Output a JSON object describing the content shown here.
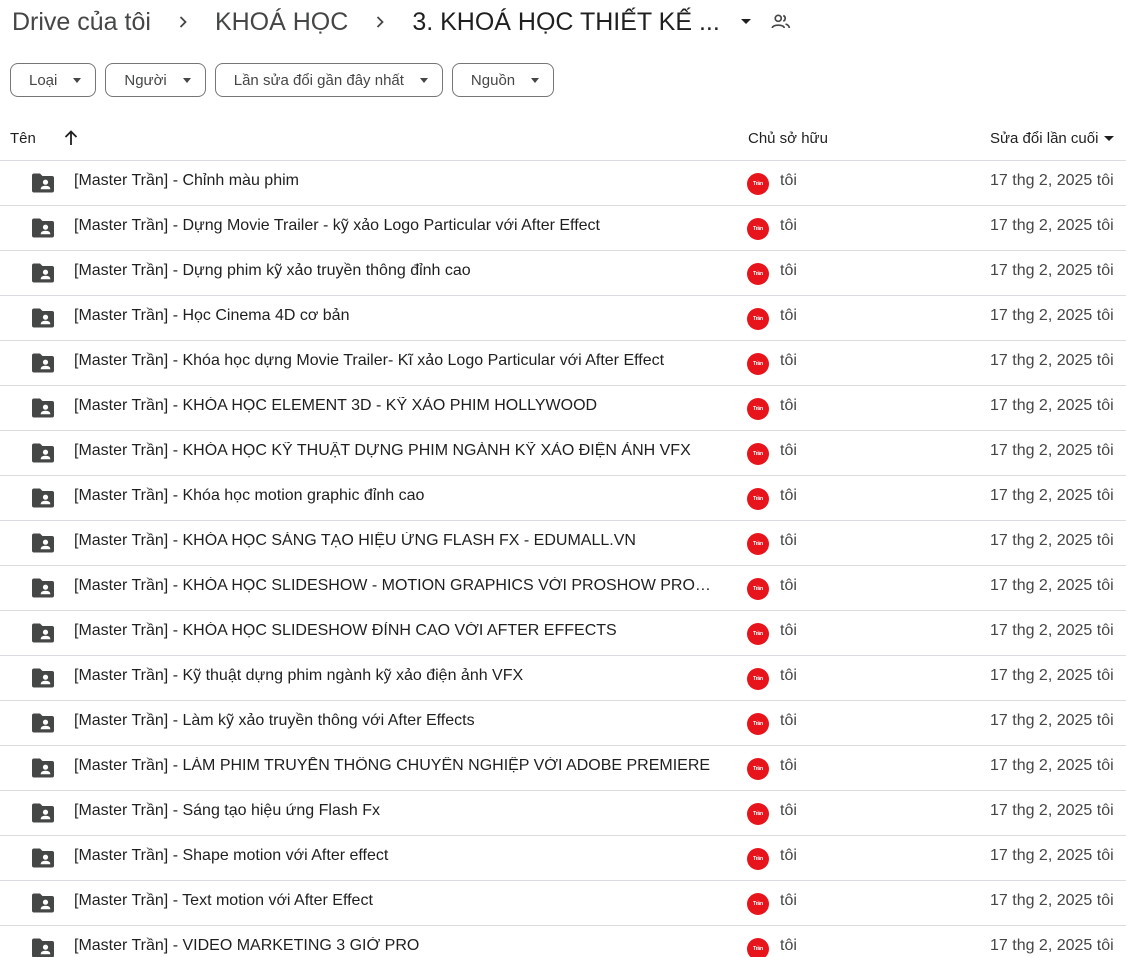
{
  "breadcrumb": {
    "root": "Drive của tôi",
    "parent": "KHOÁ HỌC",
    "current": "3. KHOÁ HỌC THIẾT KẾ ..."
  },
  "filters": [
    "Loại",
    "Người",
    "Lần sửa đổi gần đây nhất",
    "Nguồn"
  ],
  "columns": {
    "name": "Tên",
    "owner": "Chủ sở hữu",
    "modified": "Sửa đổi lần cuối"
  },
  "avatar_text": "Trần",
  "rows": [
    {
      "name": "[Master Trần] - Chỉnh màu phim",
      "owner": "tôi",
      "modified": "17 thg 2, 2025 tôi"
    },
    {
      "name": "[Master Trần] - Dựng Movie Trailer - kỹ xảo Logo Particular với After Effect",
      "owner": "tôi",
      "modified": "17 thg 2, 2025 tôi"
    },
    {
      "name": "[Master Trần] - Dựng phim kỹ xảo truyền thông đỉnh cao",
      "owner": "tôi",
      "modified": "17 thg 2, 2025 tôi"
    },
    {
      "name": "[Master Trần] - Học Cinema 4D cơ bản",
      "owner": "tôi",
      "modified": "17 thg 2, 2025 tôi"
    },
    {
      "name": "[Master Trần] - Khóa học dựng Movie Trailer- Kĩ xảo Logo Particular với After Effect",
      "owner": "tôi",
      "modified": "17 thg 2, 2025 tôi"
    },
    {
      "name": "[Master Trần] - KHÓA HỌC ELEMENT 3D - KỸ XẢO PHIM HOLLYWOOD",
      "owner": "tôi",
      "modified": "17 thg 2, 2025 tôi"
    },
    {
      "name": "[Master Trần] - KHÓA HỌC KỸ THUẬT DỰNG PHIM NGÀNH KỸ XẢO ĐIỆN ẢNH VFX",
      "owner": "tôi",
      "modified": "17 thg 2, 2025 tôi"
    },
    {
      "name": "[Master Trần] - Khóa học motion graphic đỉnh cao",
      "owner": "tôi",
      "modified": "17 thg 2, 2025 tôi"
    },
    {
      "name": "[Master Trần] - KHÓA HỌC SÁNG TẠO HIỆU ỨNG FLASH FX - EDUMALL.VN",
      "owner": "tôi",
      "modified": "17 thg 2, 2025 tôi"
    },
    {
      "name": "[Master Trần] - KHÓA HỌC SLIDESHOW - MOTION GRAPHICS VỚI PROSHOW PRODU...",
      "owner": "tôi",
      "modified": "17 thg 2, 2025 tôi"
    },
    {
      "name": "[Master Trần] - KHÓA HỌC SLIDESHOW ĐỈNH CAO VỚI AFTER EFFECTS",
      "owner": "tôi",
      "modified": "17 thg 2, 2025 tôi"
    },
    {
      "name": "[Master Trần] - Kỹ thuật dựng phim ngành kỹ xảo điện ảnh VFX",
      "owner": "tôi",
      "modified": "17 thg 2, 2025 tôi"
    },
    {
      "name": "[Master Trần] - Làm kỹ xảo truyền thông với After Effects",
      "owner": "tôi",
      "modified": "17 thg 2, 2025 tôi"
    },
    {
      "name": "[Master Trần] - LÀM PHIM TRUYỀN THÔNG CHUYÊN NGHIỆP VỚI ADOBE PREMIERE",
      "owner": "tôi",
      "modified": "17 thg 2, 2025 tôi"
    },
    {
      "name": "[Master Trần] - Sáng tạo hiệu ứng Flash Fx",
      "owner": "tôi",
      "modified": "17 thg 2, 2025 tôi"
    },
    {
      "name": "[Master Trần] - Shape motion với After effect",
      "owner": "tôi",
      "modified": "17 thg 2, 2025 tôi"
    },
    {
      "name": "[Master Trần] - Text motion với After Effect",
      "owner": "tôi",
      "modified": "17 thg 2, 2025 tôi"
    },
    {
      "name": "[Master Trần] - VIDEO MARKETING 3 GIỜ PRO",
      "owner": "tôi",
      "modified": "17 thg 2, 2025 tôi"
    }
  ],
  "icons": {
    "folder": "shared-folder-icon",
    "share": "people-icon",
    "sort": "arrow-up-icon"
  },
  "colors": {
    "avatar": "#e8141b",
    "folder": "#444746"
  }
}
